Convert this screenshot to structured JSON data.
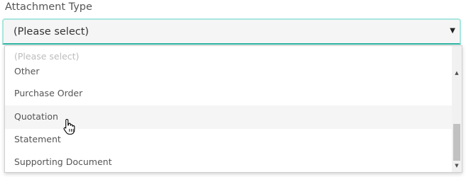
{
  "field": {
    "label": "Attachment Type",
    "selected_value": "(Please select)",
    "arrow_icon": "caret-down-icon"
  },
  "dropdown": {
    "placeholder": "(Please select)",
    "options": [
      "Other",
      "Purchase Order",
      "Quotation",
      "Statement",
      "Supporting Document"
    ],
    "hovered_option": "Quotation"
  },
  "scrollbar": {
    "up_icon": "scroll-up-arrow-icon",
    "down_icon": "scroll-down-arrow-icon"
  },
  "cursor_icon": "hand-pointer-icon"
}
